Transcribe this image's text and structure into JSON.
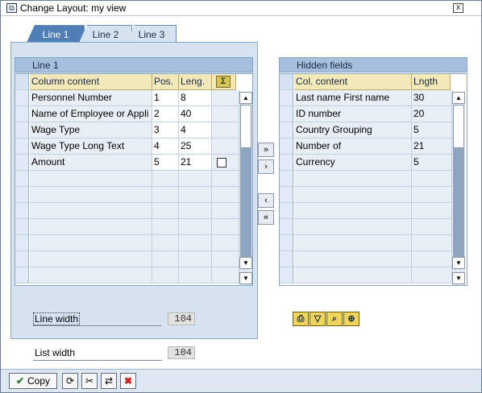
{
  "window": {
    "title": "Change Layout: my view",
    "close_glyph": "x"
  },
  "tabs": [
    {
      "label": "Line 1",
      "active": true
    },
    {
      "label": "Line 2",
      "active": false
    },
    {
      "label": "Line 3",
      "active": false
    }
  ],
  "left_group": {
    "title": "Line 1",
    "columns": [
      "Column content",
      "Pos.",
      "Leng.",
      "Σ"
    ],
    "rows": [
      {
        "content": "Personnel Number",
        "pos": "1",
        "len": "8",
        "sum": false
      },
      {
        "content": "Name of Employee or Appli",
        "pos": "2",
        "len": "40",
        "sum": false
      },
      {
        "content": "Wage Type",
        "pos": "3",
        "len": "4",
        "sum": false
      },
      {
        "content": "Wage Type Long Text",
        "pos": "4",
        "len": "25",
        "sum": false
      },
      {
        "content": "Amount",
        "pos": "5",
        "len": "21",
        "sum": true
      }
    ],
    "empty_rows": 7
  },
  "right_group": {
    "title": "Hidden fields",
    "columns": [
      "Col. content",
      "Lngth"
    ],
    "rows": [
      {
        "content": "Last name First name",
        "len": "30"
      },
      {
        "content": "ID number",
        "len": "20"
      },
      {
        "content": "Country Grouping",
        "len": "5"
      },
      {
        "content": "Number of",
        "len": "21"
      },
      {
        "content": "Currency",
        "len": "5"
      }
    ],
    "empty_rows": 7
  },
  "move_buttons": {
    "all_right": "»",
    "one_right": "›",
    "one_left": "‹",
    "all_left": "«"
  },
  "widths": {
    "line_width_label": "Line width",
    "line_width_value": "104",
    "list_width_label": "List width",
    "list_width_value": "104"
  },
  "toolbar_icons": [
    "print-icon",
    "filter-icon",
    "find-icon",
    "find-next-icon"
  ],
  "footer": {
    "copy_label": "Copy",
    "icons": [
      "refresh-icon",
      "cut-icon",
      "transfer-icon",
      "cancel-icon"
    ]
  },
  "colors": {
    "tab_active": "#4f7fb6",
    "panel_bg": "#d6e3f1",
    "header_bg": "#f3e8b8",
    "cancel_red": "#c21f1f"
  }
}
